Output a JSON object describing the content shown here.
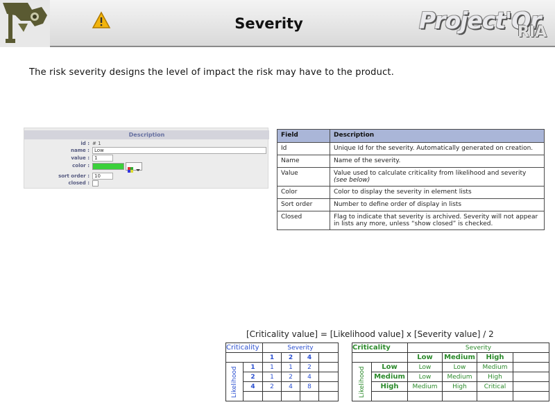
{
  "header": {
    "title": "Severity",
    "brand_main": "Project'Or",
    "brand_sub": "RIA"
  },
  "intro": "The risk severity designs the level of impact the risk may have to the product.",
  "form": {
    "section_title": "Description",
    "fields": {
      "id_label": "id :",
      "id_value": "# 1",
      "name_label": "name :",
      "name_value": "Low",
      "value_label": "value :",
      "value_value": "1",
      "color_label": "color :",
      "color_value": "#3bd03b",
      "sort_label": "sort order :",
      "sort_value": "10",
      "closed_label": "closed :"
    }
  },
  "field_table": {
    "headers": [
      "Field",
      "Description"
    ],
    "rows": [
      {
        "field": "Id",
        "description": "Unique Id for the severity. Automatically generated on creation."
      },
      {
        "field": "Name",
        "description": "Name of the severity."
      },
      {
        "field": "Value",
        "description": "Value used to calculate criticality from likelihood and severity",
        "note": "(see below)"
      },
      {
        "field": "Color",
        "description": "Color to display the severity in element lists"
      },
      {
        "field": "Sort order",
        "description": "Number to define order of display in lists"
      },
      {
        "field": "Closed",
        "description": "Flag to indicate that severity is archived. Severity will not appear in lists any more, unless “show closed” is checked."
      }
    ]
  },
  "formula": "[Criticality value] = [Likelihood value] x [Severity value] / 2",
  "grid_numeric": {
    "corner": "Criticality",
    "severity": "Severity",
    "likelihood": "Likelihood",
    "cols": [
      "1",
      "2",
      "4"
    ],
    "rows": [
      {
        "label": "1",
        "cells": [
          "1",
          "1",
          "2"
        ]
      },
      {
        "label": "2",
        "cells": [
          "1",
          "2",
          "4"
        ]
      },
      {
        "label": "4",
        "cells": [
          "2",
          "4",
          "8"
        ]
      }
    ]
  },
  "grid_words": {
    "corner": "Criticality",
    "severity": "Severity",
    "likelihood": "Likelihood",
    "cols": [
      "Low",
      "Medium",
      "High"
    ],
    "rows": [
      {
        "label": "Low",
        "cells": [
          "Low",
          "Low",
          "Medium"
        ]
      },
      {
        "label": "Medium",
        "cells": [
          "Low",
          "Medium",
          "High"
        ]
      },
      {
        "label": "High",
        "cells": [
          "Medium",
          "High",
          "Critical"
        ]
      }
    ]
  },
  "colors": {
    "header_bg": "#d9d9d9",
    "table_header": "#aab6d8",
    "numeric_grid": "#2a4fd0",
    "word_grid": "#2b8a2b",
    "warning": "#f2b40c"
  },
  "icons": {
    "logo": "surveillance-camera-logo",
    "warning": "warning-triangle-icon"
  }
}
